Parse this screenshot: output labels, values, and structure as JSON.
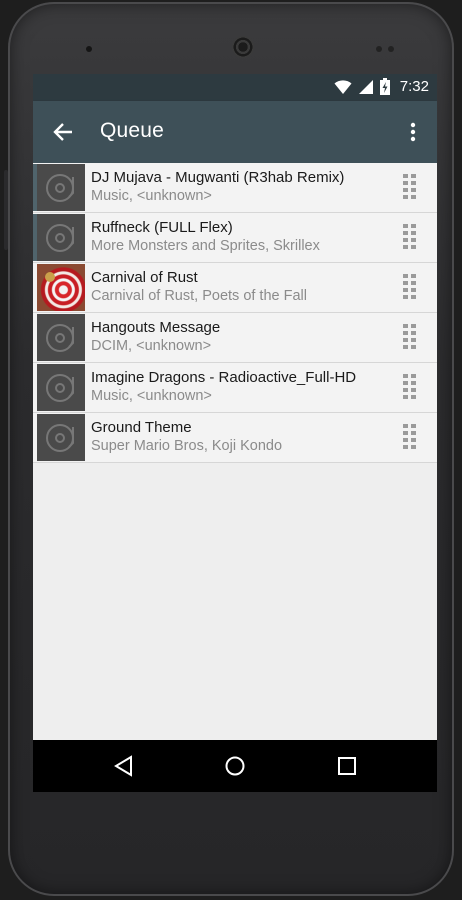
{
  "status_bar": {
    "time": "7:32",
    "icons": [
      "wifi-icon",
      "cell-signal-icon",
      "battery-charging-icon"
    ]
  },
  "app_bar": {
    "title": "Queue",
    "back_icon": "arrow-back-icon",
    "menu_icon": "more-vert-icon"
  },
  "queue": [
    {
      "title": "DJ Mujava - Mugwanti (R3hab Remix)",
      "subtitle": "Music, <unknown>",
      "art": "default-disc",
      "active": true
    },
    {
      "title": "Ruffneck (FULL Flex)",
      "subtitle": "More Monsters and Sprites, Skrillex",
      "art": "default-disc",
      "active": true
    },
    {
      "title": "Carnival of Rust",
      "subtitle": "Carnival of Rust, Poets of the Fall",
      "art": "album-cover",
      "active": false
    },
    {
      "title": "Hangouts Message",
      "subtitle": "DCIM, <unknown>",
      "art": "default-disc",
      "active": false
    },
    {
      "title": "Imagine Dragons - Radioactive_Full-HD",
      "subtitle": "Music, <unknown>",
      "art": "default-disc",
      "active": false
    },
    {
      "title": "Ground Theme",
      "subtitle": "Super Mario Bros, Koji Kondo",
      "art": "default-disc",
      "active": false
    }
  ],
  "nav_bar": {
    "buttons": [
      "back-triangle-icon",
      "home-circle-icon",
      "recents-square-icon"
    ]
  },
  "colors": {
    "status_bar": "#2d3a40",
    "app_bar": "#3e5058",
    "list_bg": "#eeeeee",
    "row_bg": "#f3f3f3",
    "secondary_text": "#8b8b8b",
    "accent": "#50646c"
  }
}
